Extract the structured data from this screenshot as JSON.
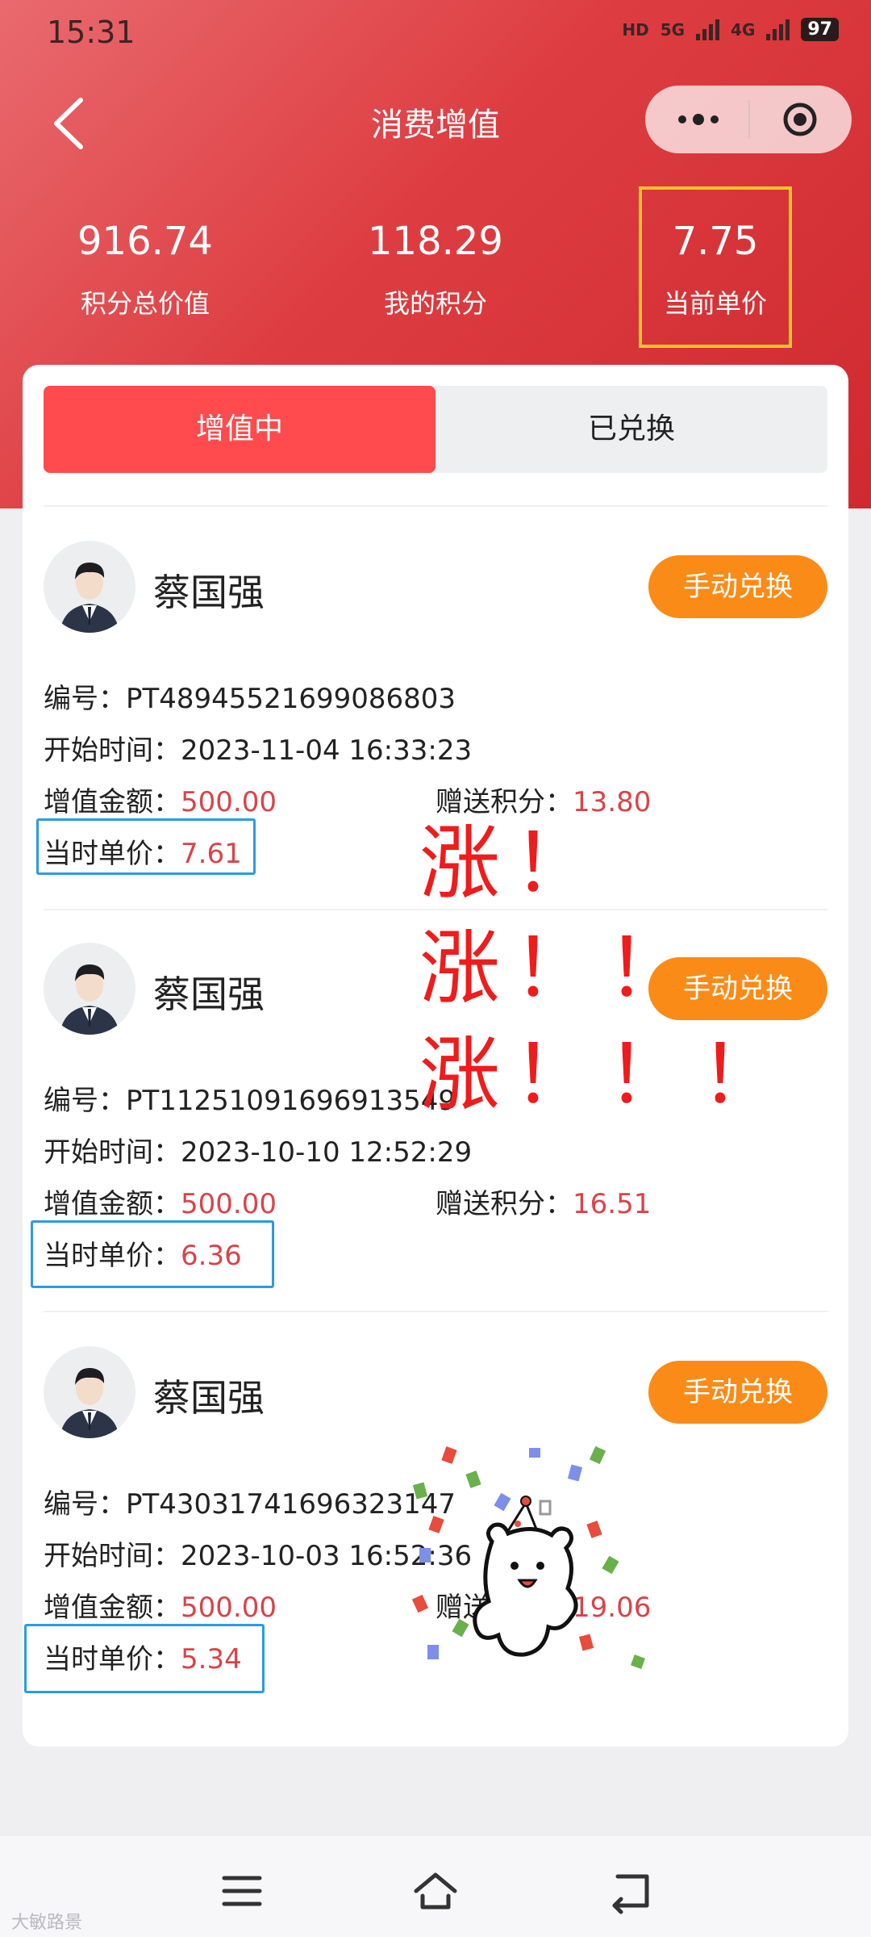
{
  "status_bar": {
    "time": "15:31",
    "hd": "HD",
    "net1": "5G",
    "net2": "4G",
    "battery": "97"
  },
  "header": {
    "title": "消费增值"
  },
  "stats": [
    {
      "value": "916.74",
      "label": "积分总价值"
    },
    {
      "value": "118.29",
      "label": "我的积分"
    },
    {
      "value": "7.75",
      "label": "当前单价"
    }
  ],
  "tabs": {
    "active": "增值中",
    "inactive": "已兑换"
  },
  "records": [
    {
      "name": "蔡国强",
      "button": "手动兑换",
      "id_label": "编号：",
      "id": "PT48945521699086803",
      "start_label": "开始时间：",
      "start": "2023-11-04 16:33:23",
      "amount_label": "增值金额：",
      "amount": "500.00",
      "bonus_label": "赠送积分：",
      "bonus": "13.80",
      "price_label": "当时单价：",
      "price": "7.61"
    },
    {
      "name": "蔡国强",
      "button": "手动兑换",
      "id_label": "编号：",
      "id": "PT11251091696913549",
      "start_label": "开始时间：",
      "start": "2023-10-10 12:52:29",
      "amount_label": "增值金额：",
      "amount": "500.00",
      "bonus_label": "赠送积分：",
      "bonus": "16.51",
      "price_label": "当时单价：",
      "price": "6.36"
    },
    {
      "name": "蔡国强",
      "button": "手动兑换",
      "id_label": "编号：",
      "id": "PT43031741696323147",
      "start_label": "开始时间：",
      "start": "2023-10-03 16:52:36",
      "amount_label": "增值金额：",
      "amount": "500.00",
      "bonus_label": "赠送积分：",
      "bonus": "19.06",
      "price_label": "当时单价：",
      "price": "5.34"
    }
  ],
  "annotation": {
    "line1": "涨！",
    "line2": "涨！！",
    "line3": "涨！！！"
  },
  "watermark": "大敏路景",
  "colors": {
    "header_red": "#dd3d41",
    "tab_active": "#ff4a4e",
    "button_orange": "#fb8b17",
    "value_red": "#d9434a",
    "highlight_yellow": "#f7c12c",
    "box_blue": "#2d9ae6"
  }
}
